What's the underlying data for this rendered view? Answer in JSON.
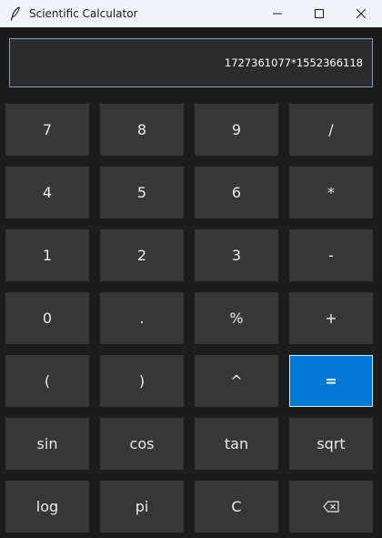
{
  "window": {
    "title": "Scientific Calculator",
    "app_icon": "feather-icon",
    "controls": [
      "minimize-icon",
      "maximize-icon",
      "close-icon"
    ]
  },
  "display": {
    "value": "1727361077*1552366118"
  },
  "keypad": {
    "row1": [
      "7",
      "8",
      "9",
      "/"
    ],
    "row2": [
      "4",
      "5",
      "6",
      "*"
    ],
    "row3": [
      "1",
      "2",
      "3",
      "-"
    ],
    "row4": [
      "0",
      ".",
      "%",
      "+"
    ],
    "row5": [
      "(",
      ")",
      "^",
      "="
    ],
    "row6": [
      "sin",
      "cos",
      "tan",
      "sqrt"
    ],
    "row7": [
      "log",
      "pi",
      "C",
      "backspace-icon"
    ]
  },
  "colors": {
    "background": "#1c1c1c",
    "button": "#373737",
    "accent": "#0078d4",
    "titlebar": "#eef6f9",
    "display_border": "#7b9fbd"
  }
}
